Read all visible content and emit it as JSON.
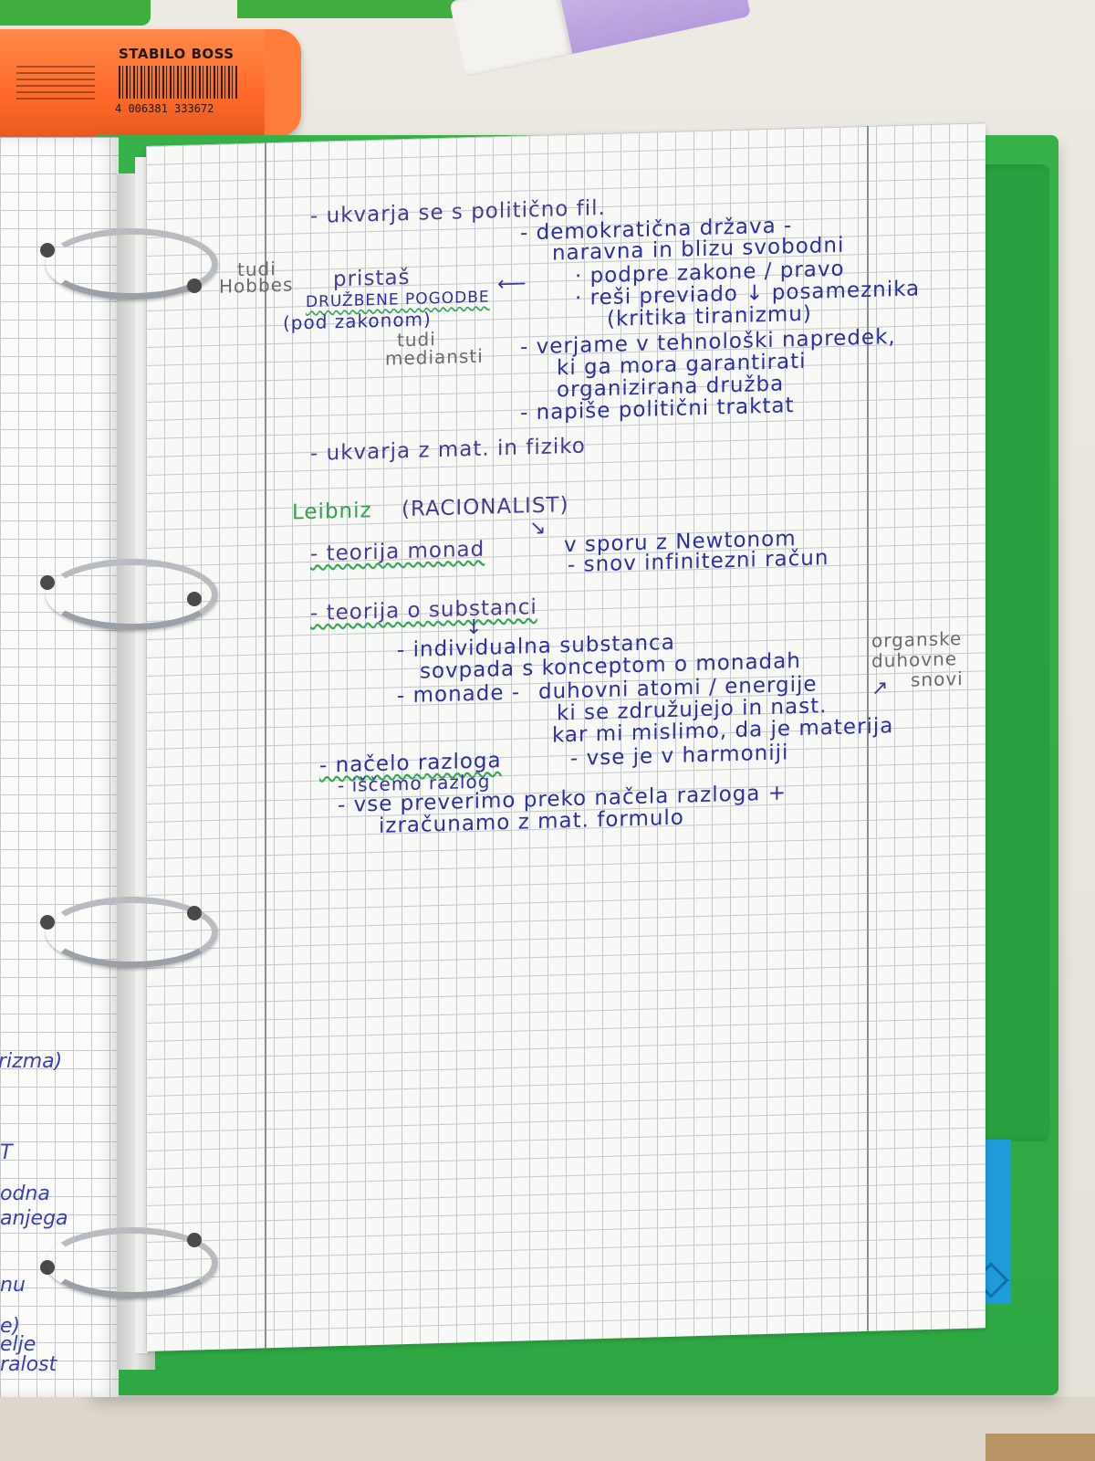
{
  "marker": {
    "brand": "STABILO BOSS",
    "barcode": "4 006381 333672"
  },
  "notes": {
    "l1": "- ukvarja se s politično fil.",
    "l2": "- demokratična država -",
    "l3": "naravna in blizu svobodni",
    "l4": "· podpre zakone / pravo",
    "l5": "· reši previado ↓ posameznika",
    "l6": "(kritika tiranizmu)",
    "l7": "- verjame v tehnološki napredek,",
    "l8": "ki ga mora garantirati",
    "l9": "organizirana družba",
    "l10": "- napiše politični traktat",
    "side1": "tudi",
    "side2": "Hobbes",
    "side3": "pristaš",
    "side4": "DRUŽBENE POGODBE",
    "side5": "(pod zakonom)",
    "side6": "tudi",
    "side7": "mediansti",
    "l11": "- ukvarja z mat. in fiziko",
    "heading": "Leibniz",
    "heading_paren": "(RACIONALIST)",
    "l12": "- teorija monad",
    "l13": "v sporu z Newtonom",
    "l14": "- snov infinitezni račun",
    "l15": "- teorija o substanci",
    "l16": "- individualna substanca",
    "l17": "sovpada s konceptom o monadah",
    "l18": "- monade -",
    "l19": "duhovni atomi / energije",
    "l20": "ki se združujejo in nast.",
    "l21": "kar mi mislimo, da je materija",
    "r1": "organske",
    "r2": "duhovne",
    "r3": "snovi",
    "l22": "- načelo razloga",
    "l23": "- vse je v harmoniji",
    "l24": "- iščemo razlog",
    "l25": "- vse preverimo preko načela razloga +",
    "l26": "izračunamo z mat. formulo"
  },
  "left_page": {
    "t1": "rizma)",
    "t2": "T",
    "t3": "odna",
    "t4": "anjega",
    "t5": "nu",
    "t6": "e)",
    "t7": "elje",
    "t8": "ralost"
  }
}
